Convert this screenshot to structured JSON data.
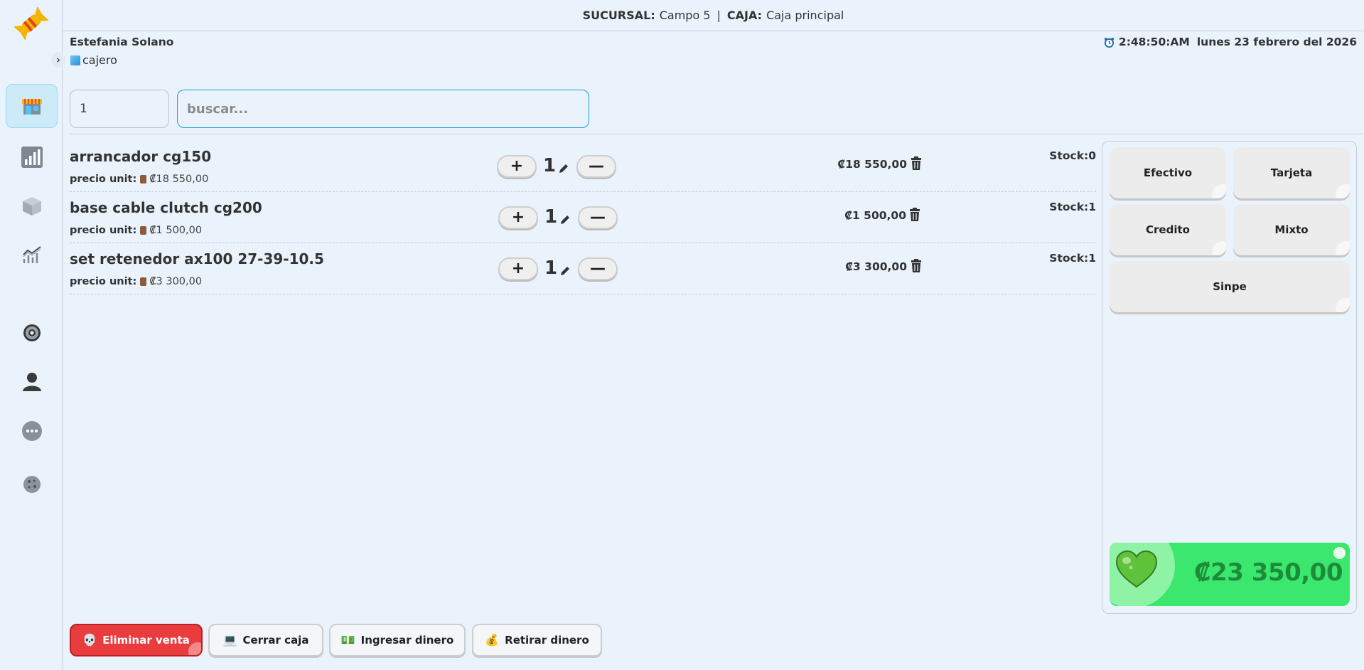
{
  "topbar": {
    "branch_label": "SUCURSAL:",
    "branch_value": "Campo 5",
    "separator": "|",
    "register_label": "CAJA:",
    "register_value": "Caja principal"
  },
  "user": {
    "name": "Estefania Solano",
    "role": "cajero"
  },
  "clock": {
    "time": "2:48:50:AM",
    "date": "lunes 23 febrero del 2026"
  },
  "inputs": {
    "quantity_value": "1",
    "search_placeholder": "buscar..."
  },
  "nav": {
    "icons": [
      "store-icon",
      "bar-chart-icon",
      "box-icon",
      "trend-chart-icon",
      "gear-icon",
      "user-icon",
      "more-icon",
      "cookie-icon"
    ]
  },
  "products": [
    {
      "name": "arrancador cg150",
      "unit_label": "precio unit:",
      "unit_price": "₡18 550,00",
      "qty": "1",
      "total": "₡18 550,00",
      "stock": "Stock:0"
    },
    {
      "name": "base cable clutch cg200",
      "unit_label": "precio unit:",
      "unit_price": "₡1 500,00",
      "qty": "1",
      "total": "₡1 500,00",
      "stock": "Stock:1"
    },
    {
      "name": "set retenedor ax100 27-39-10.5",
      "unit_label": "precio unit:",
      "unit_price": "₡3 300,00",
      "qty": "1",
      "total": "₡3 300,00",
      "stock": "Stock:1"
    }
  ],
  "controls": {
    "plus": "+",
    "minus": "—"
  },
  "payment": {
    "efectivo": "Efectivo",
    "tarjeta": "Tarjeta",
    "credito": "Credito",
    "mixto": "Mixto",
    "sinpe": "Sinpe",
    "total": "₡23 350,00"
  },
  "actions": {
    "eliminar": "Eliminar venta",
    "cerrar": "Cerrar caja",
    "ingresar": "Ingresar dinero",
    "retirar": "Retirar dinero"
  },
  "colors": {
    "accent": "#1e9fd6",
    "danger": "#ea3c3f",
    "total_bg": "#3ce76d",
    "total_text": "#1c8c3a"
  }
}
